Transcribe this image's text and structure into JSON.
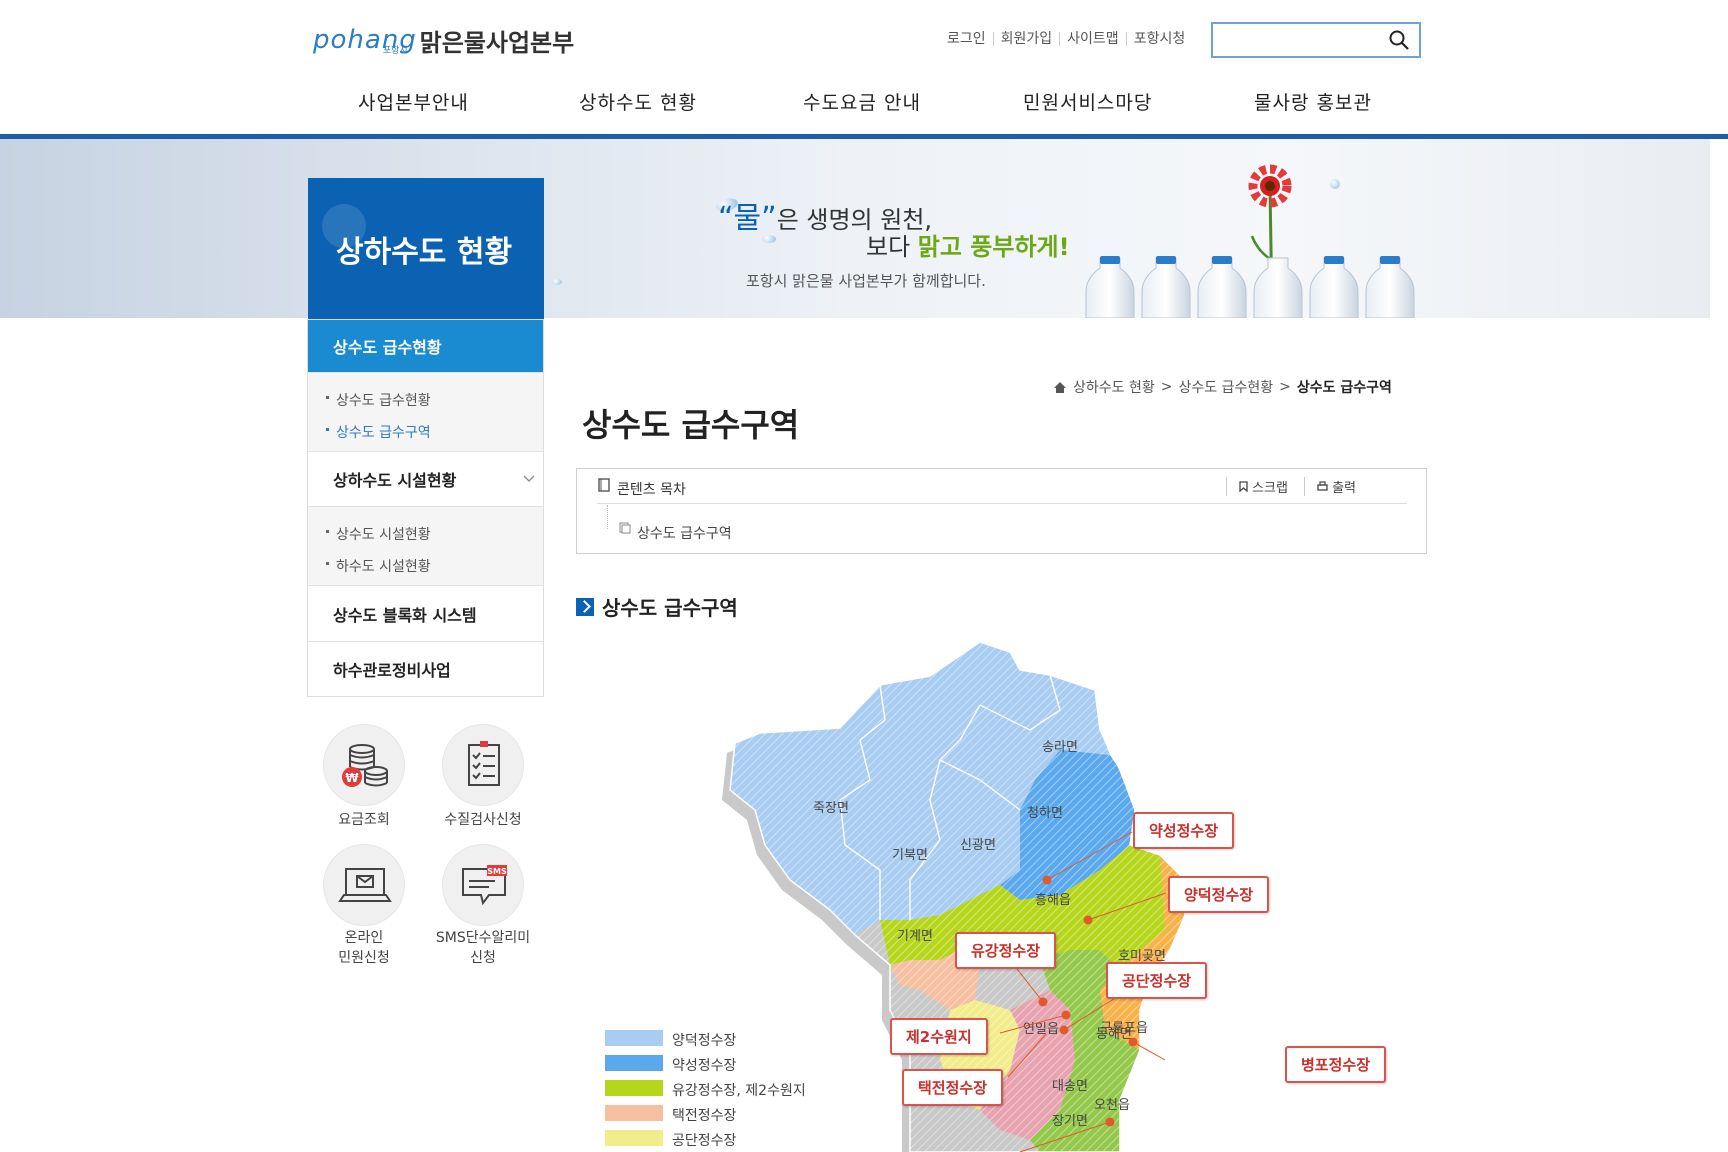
{
  "header": {
    "logo_en": "pohang",
    "logo_city": "포항시",
    "logo_kr": "맑은물사업본부",
    "util": [
      "로그인",
      "회원가입",
      "사이트맵",
      "포항시청"
    ],
    "search_placeholder": ""
  },
  "gnb": [
    "사업본부안내",
    "상하수도 현황",
    "수도요금 안내",
    "민원서비스마당",
    "물사랑 홍보관"
  ],
  "banner": {
    "side_title": "상하수도 현황",
    "slogan_word": "“물”",
    "slogan_rest": "은 생명의 원천,",
    "slogan2_pre": "보다 ",
    "slogan2_hl": "맑고 풍부하게!",
    "slogan3": "포항시 맑은물 사업본부가 함께합니다."
  },
  "lnb": {
    "active_head": "상수도 급수현황",
    "sub1": [
      "상수도 급수현황",
      "상수도 급수구역"
    ],
    "head2": "상하수도 시설현황",
    "sub2": [
      "상수도 시설현황",
      "하수도 시설현황"
    ],
    "head3": "상수도 블록화 시스템",
    "head4": "하수관로정비사업"
  },
  "quick": [
    {
      "label": "요금조회",
      "icon": "coin-stack-icon"
    },
    {
      "label": "수질검사신청",
      "icon": "clipboard-checklist-icon"
    },
    {
      "label": "온라인\n민원신청",
      "label1": "온라인",
      "label2": "민원신청",
      "icon": "laptop-mail-icon"
    },
    {
      "label": "SMS단수알리미\n신청",
      "label1": "SMS단수알리미",
      "label2": "신청",
      "icon": "sms-message-icon"
    }
  ],
  "breadcrumb": [
    "상하수도 현황",
    "상수도 급수현황",
    "상수도 급수구역"
  ],
  "page_title": "상수도 급수구역",
  "toc": {
    "title": "콘텐츠 목차",
    "scrap": "스크랩",
    "print": "출력",
    "item": "상수도 급수구역"
  },
  "section_title": "상수도 급수구역",
  "map": {
    "areas": [
      "송라면",
      "죽장면",
      "청하면",
      "기북면",
      "신광면",
      "흥해읍",
      "기계면",
      "호미곶면",
      "연일읍",
      "동해면",
      "구룡포읍",
      "대송면",
      "오천읍",
      "장기면"
    ],
    "plants": [
      "약성정수장",
      "양덕정수장",
      "유강정수장",
      "공단정수장",
      "제2수원지",
      "택전정수장",
      "병포정수장"
    ],
    "legend": [
      "양덕정수장",
      "약성정수장",
      "유강정수장, 제2수원지",
      "택전정수장",
      "공단정수장"
    ],
    "colors": {
      "yangdeok": "#a9ccf2",
      "yakseong": "#5aa8ee",
      "yugang": "#b6d61c",
      "taekjeon": "#f6bfa0",
      "gongdan": "#f2ec8a",
      "byeongpo": "#f7b24a",
      "ocheon": "#e7a3b0",
      "jangi": "#93c84a"
    }
  }
}
